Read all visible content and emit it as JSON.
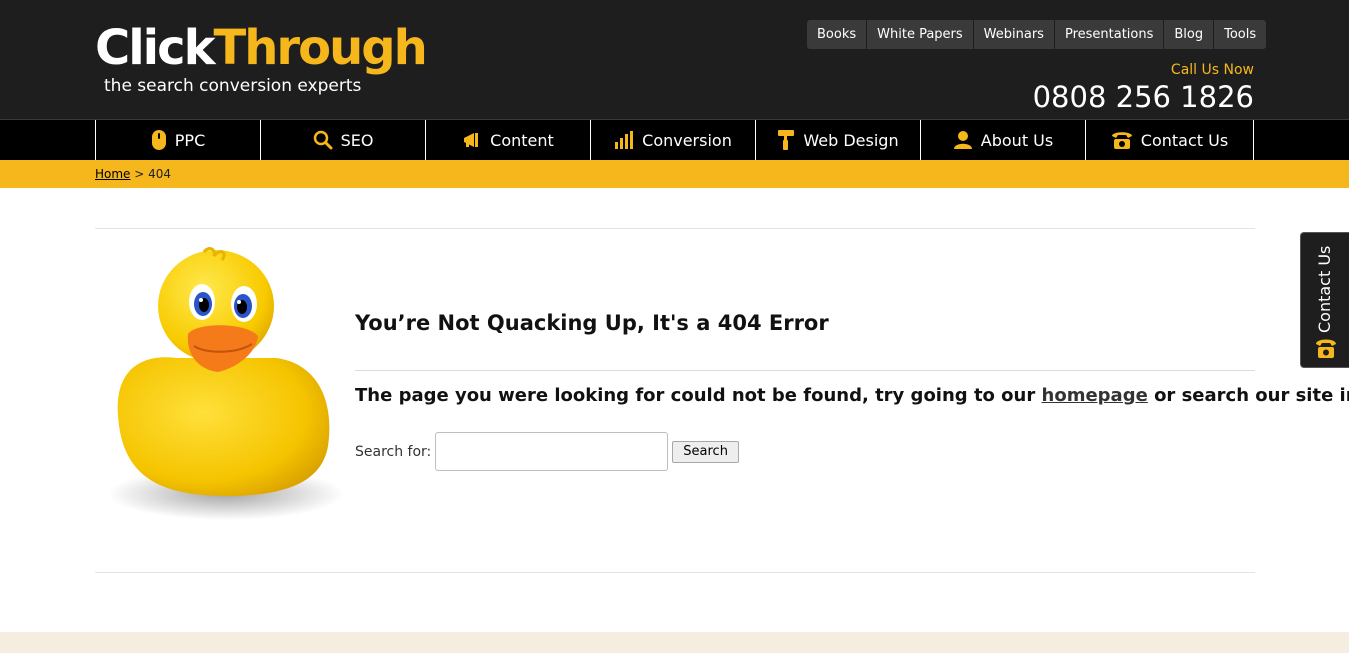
{
  "logo": {
    "click": "Click",
    "through": "Through",
    "tagline": "the search conversion experts"
  },
  "topnav": [
    {
      "label": "Books"
    },
    {
      "label": "White Papers"
    },
    {
      "label": "Webinars"
    },
    {
      "label": "Presentations"
    },
    {
      "label": "Blog"
    },
    {
      "label": "Tools"
    }
  ],
  "contact": {
    "call_label": "Call Us Now",
    "phone": "0808 256 1826"
  },
  "mainnav": [
    {
      "label": "PPC",
      "icon": "mouse-icon"
    },
    {
      "label": "SEO",
      "icon": "search-icon"
    },
    {
      "label": "Content",
      "icon": "megaphone-icon"
    },
    {
      "label": "Conversion",
      "icon": "bar-chart-icon"
    },
    {
      "label": "Web Design",
      "icon": "paint-roller-icon"
    },
    {
      "label": "About Us",
      "icon": "person-icon"
    },
    {
      "label": "Contact Us",
      "icon": "telephone-icon"
    }
  ],
  "breadcrumb": {
    "home": "Home",
    "separator": " > ",
    "current": "404"
  },
  "error": {
    "heading": "You’re Not Quacking Up, It's a 404 Error",
    "message_before": "The page you were looking for could not be found, try going to our ",
    "message_link": "homepage",
    "message_after": " or search our site instead"
  },
  "search": {
    "label": "Search for:",
    "value": "",
    "button": "Search"
  },
  "sidetab": {
    "label": "Contact Us",
    "icon": "telephone-icon"
  },
  "colors": {
    "brand_yellow": "#f6b71c",
    "header_dark": "#1e1e1e",
    "nav_black": "#000000",
    "footer_band": "#f4ede0"
  }
}
